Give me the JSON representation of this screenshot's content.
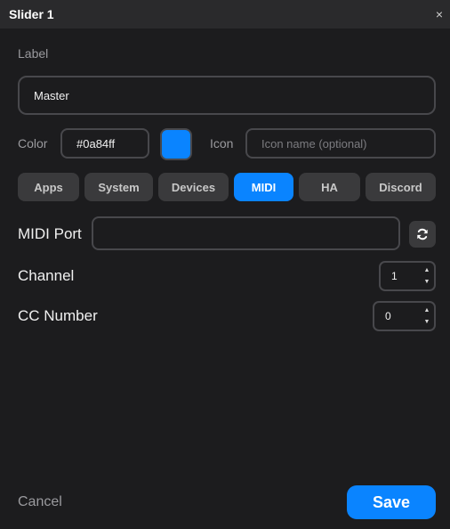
{
  "window": {
    "title": "Slider 1",
    "close_glyph": "×"
  },
  "label_field": {
    "caption": "Label",
    "value": "Master"
  },
  "color_field": {
    "caption": "Color",
    "value": "#0a84ff",
    "swatch_color": "#0a84ff"
  },
  "icon_field": {
    "caption": "Icon",
    "placeholder": "Icon name (optional)",
    "value": ""
  },
  "tabs": [
    {
      "label": "Apps",
      "active": false
    },
    {
      "label": "System",
      "active": false
    },
    {
      "label": "Devices",
      "active": false
    },
    {
      "label": "MIDI",
      "active": true
    },
    {
      "label": "HA",
      "active": false
    },
    {
      "label": "Discord",
      "active": false
    }
  ],
  "midi": {
    "port_label": "MIDI Port",
    "port_value": "",
    "refresh_icon": "refresh-icon",
    "channel_label": "Channel",
    "channel_value": "1",
    "cc_label": "CC Number",
    "cc_value": "0"
  },
  "footer": {
    "cancel_label": "Cancel",
    "save_label": "Save"
  }
}
